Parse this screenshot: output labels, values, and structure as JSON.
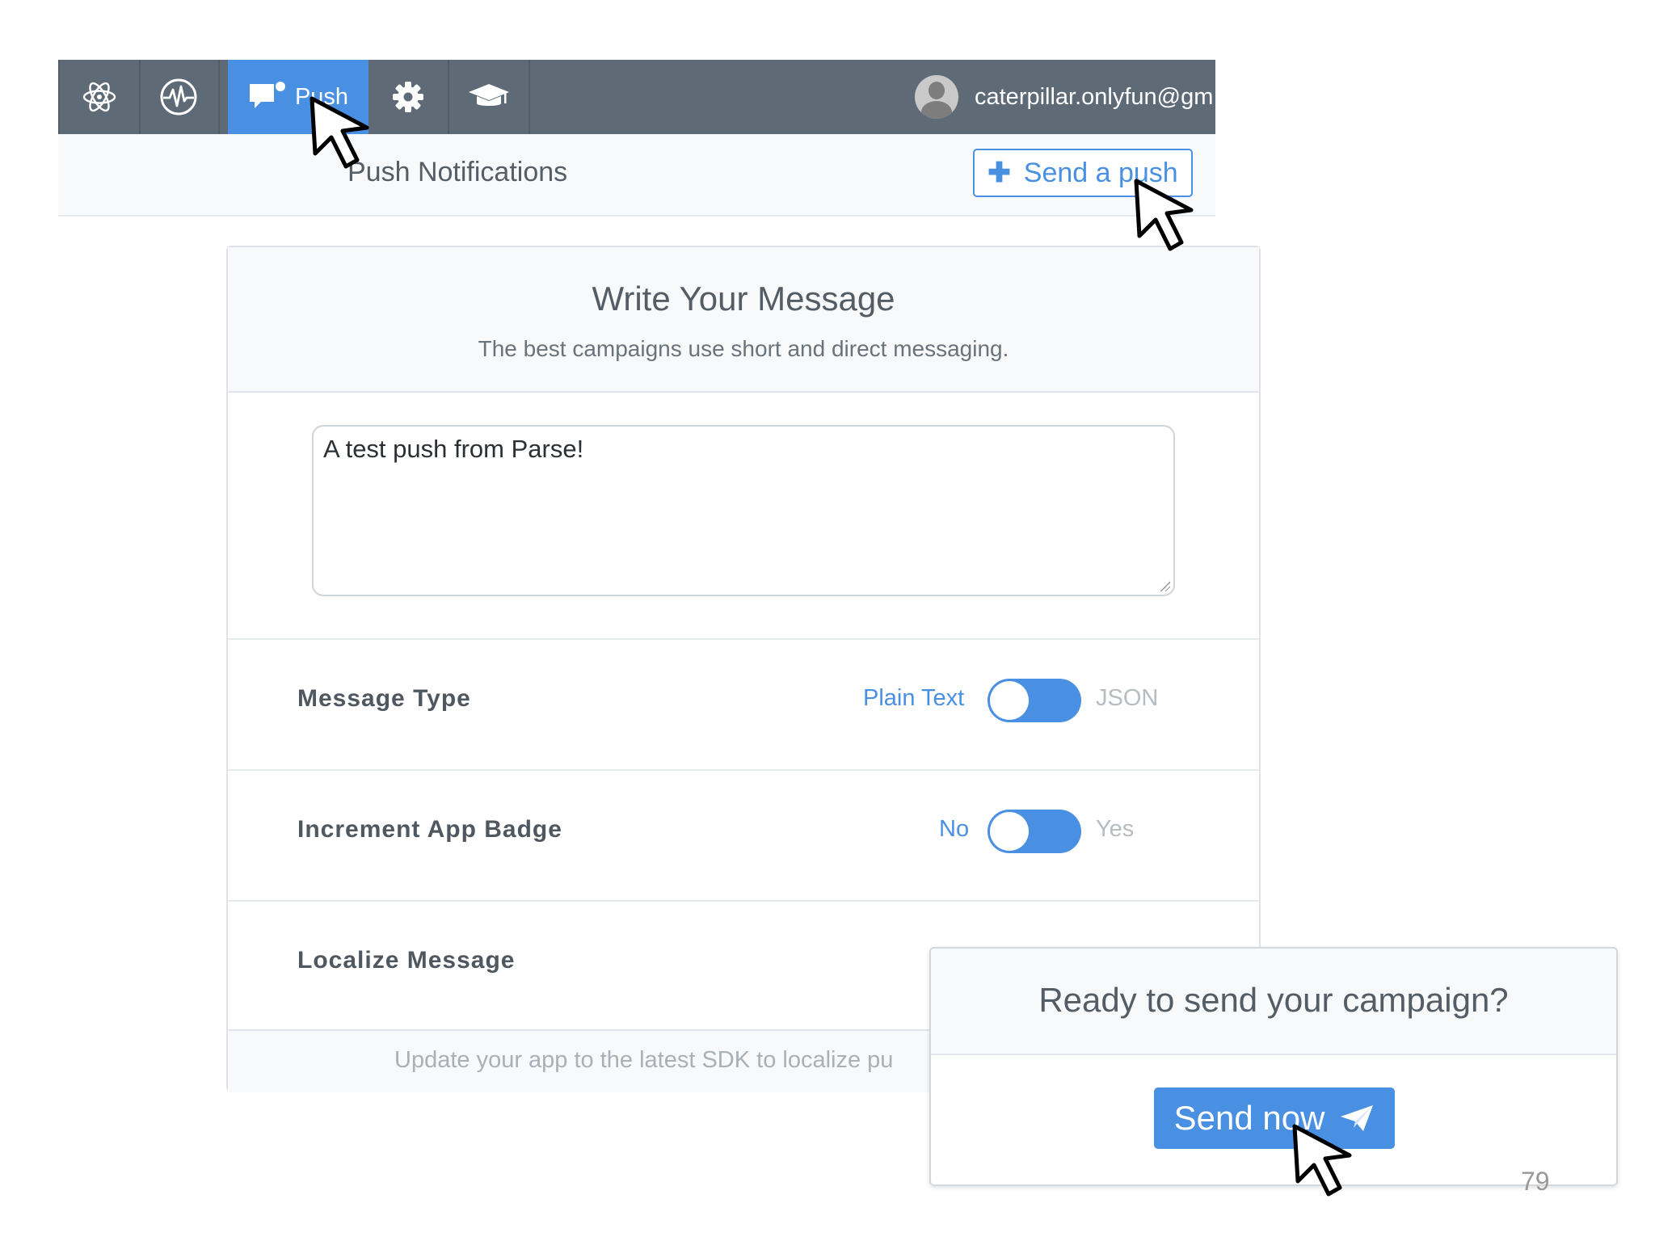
{
  "navbar": {
    "items": [
      {
        "icon": "atom-icon"
      },
      {
        "icon": "pulse-icon"
      },
      {
        "icon": "push-chat-icon",
        "label": "Push",
        "active": true
      },
      {
        "icon": "gear-icon"
      },
      {
        "icon": "graduation-cap-icon"
      }
    ],
    "user_email": "caterpillar.onlyfun@gm...",
    "colors": {
      "bar": "#5e6b77",
      "active": "#4a90e2"
    }
  },
  "subheader": {
    "title": "Push Notifications",
    "send_push_label": "Send a push"
  },
  "composer": {
    "title": "Write Your Message",
    "subtitle": "The best campaigns use short and direct messaging.",
    "message_value": "A test push from Parse!",
    "rows": [
      {
        "label": "Message Type",
        "left_option": "Plain Text",
        "right_option": "JSON"
      },
      {
        "label": "Increment App Badge",
        "left_option": "No",
        "right_option": "Yes"
      },
      {
        "label": "Localize Message"
      }
    ],
    "footer_note": "Update your app to the latest SDK to localize pu"
  },
  "modal": {
    "title": "Ready to send your campaign?",
    "send_now_label": "Send now"
  },
  "page_number": "79",
  "accent_color": "#4a90e2"
}
